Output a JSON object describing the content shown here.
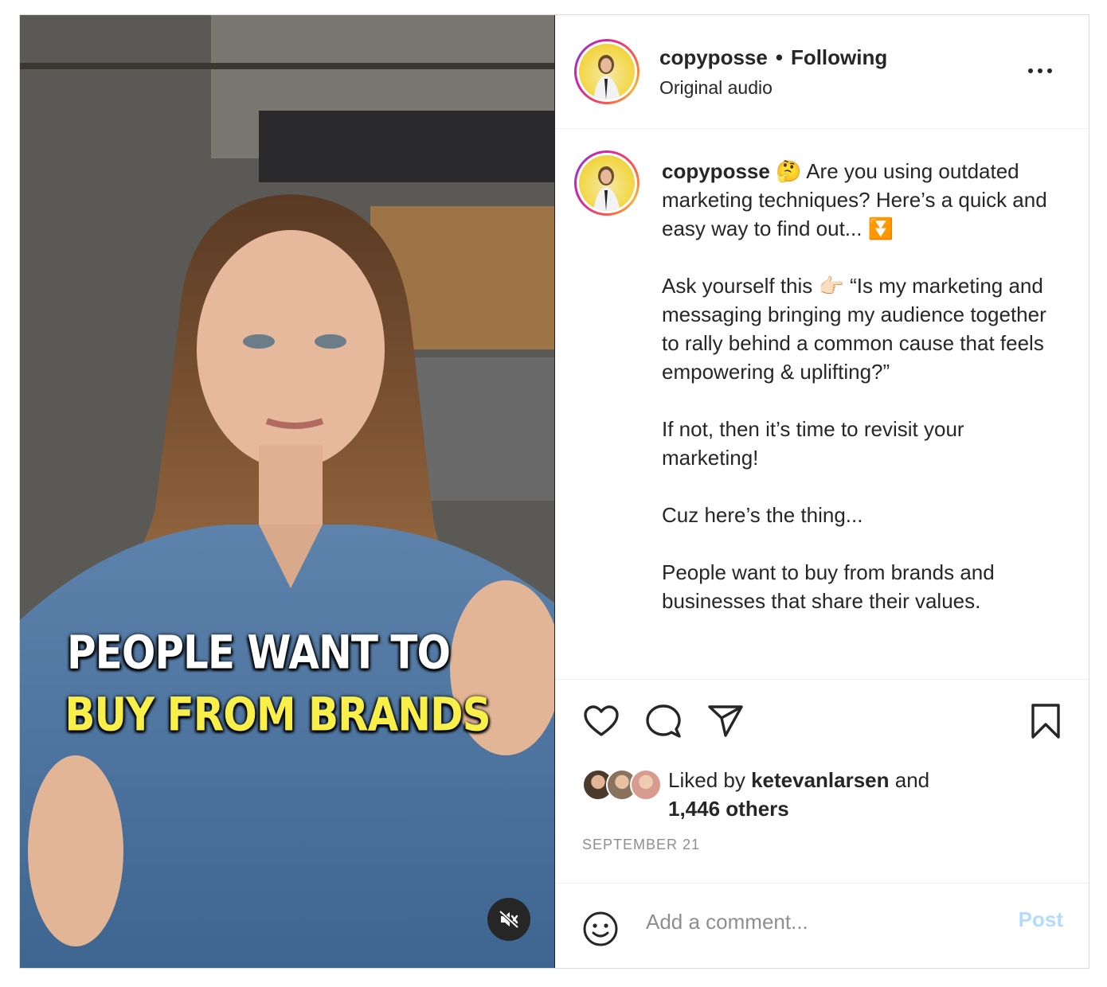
{
  "post": {
    "username": "copyposse",
    "follow_status": "Following",
    "separator": "•",
    "audio": "Original audio",
    "video_overlay": {
      "line1": "PEOPLE WANT TO",
      "line2": "BUY FROM BRANDS"
    },
    "caption": {
      "username": "copyposse",
      "text": " 🤔 Are you using outdated marketing techniques? Here’s a quick and easy way to find out... ⏬\n\nAsk yourself this 👉🏻 “Is my marketing and messaging bringing my audience together to rally behind a common cause that feels empowering & uplifting?”\n\nIf not, then it’s time to revisit your marketing!\n\nCuz here’s the thing...\n\nPeople want to buy from brands and businesses that share their values."
    },
    "likes": {
      "prefix": "Liked by ",
      "user": "ketevanlarsen",
      "middle": " and",
      "others": "1,446 others"
    },
    "date": "SEPTEMBER 21",
    "comment": {
      "placeholder": "Add a comment...",
      "post_label": "Post"
    }
  },
  "colors": {
    "text": "#262626",
    "muted": "#8e8e8e",
    "post_disabled": "#b3dbff",
    "overlay_yellow": "#f9ef4a"
  },
  "icons": [
    "heart-icon",
    "comment-icon",
    "share-icon",
    "bookmark-icon",
    "emoji-icon",
    "more-icon",
    "mute-icon"
  ]
}
